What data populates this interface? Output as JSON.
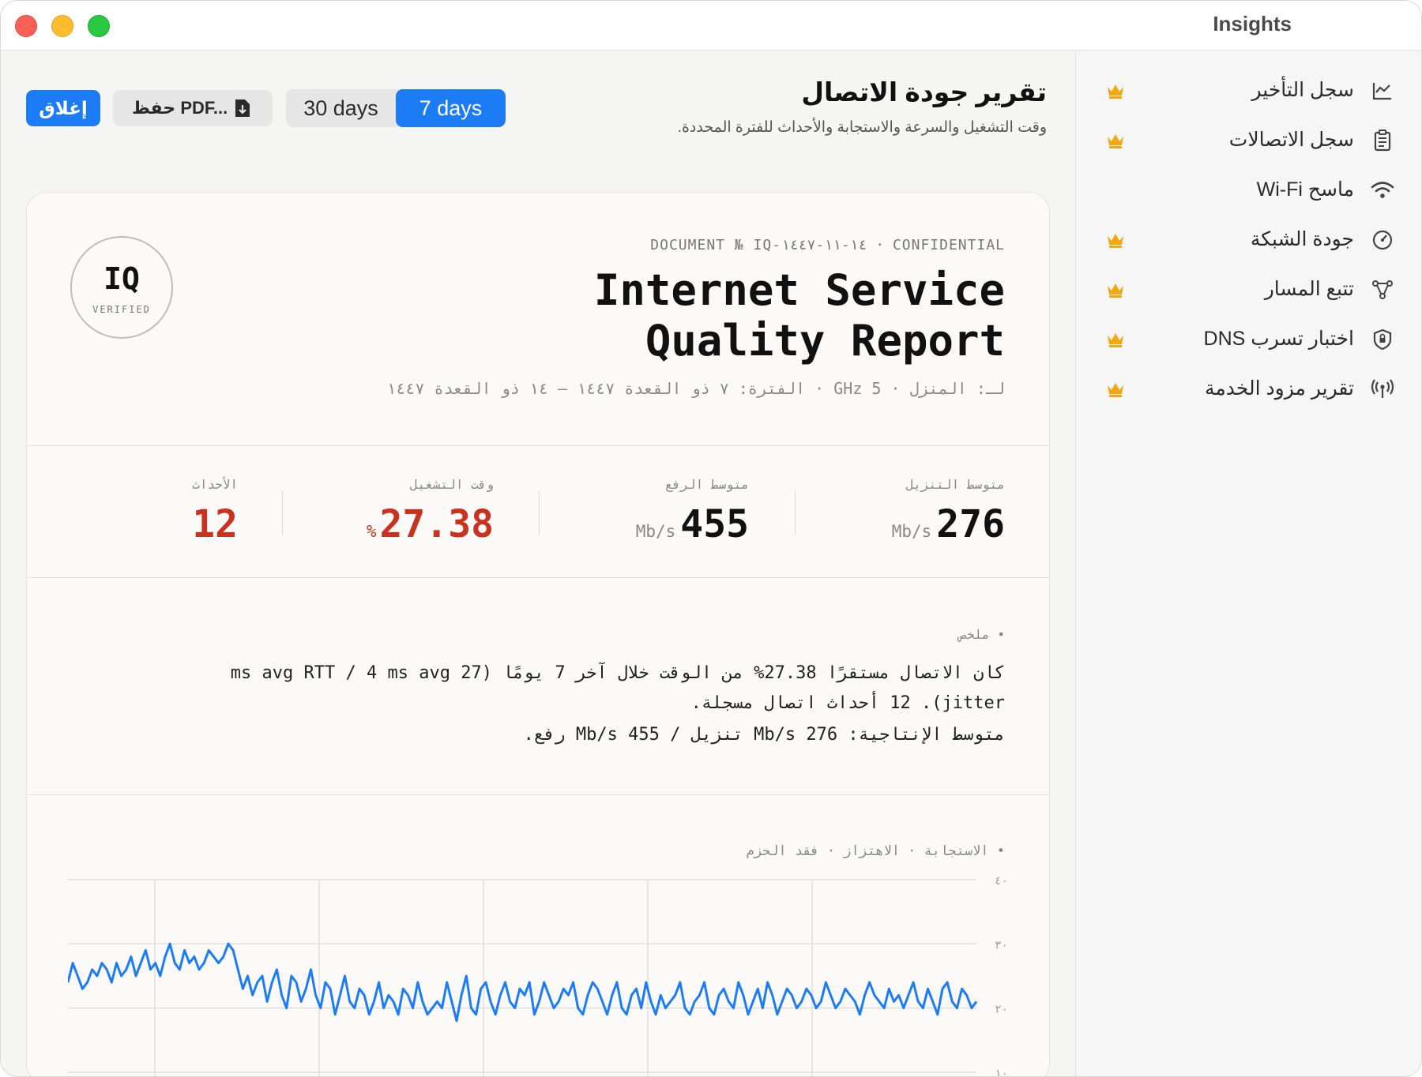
{
  "window": {
    "app_title": "Insights"
  },
  "toolbar": {
    "close_label": "إغلاق",
    "pdf_label": "حفظ PDF...",
    "range_30": "30 days",
    "range_7": "7 days",
    "selected_range": "7 days"
  },
  "header": {
    "title": "تقرير جودة الاتصال",
    "subtitle": "وقت التشغيل والسرعة والاستجابة والأحداث للفترة المحددة."
  },
  "sidebar": {
    "items": [
      {
        "label": "سجل التأخير",
        "icon": "chart-icon",
        "premium": true
      },
      {
        "label": "سجل الاتصالات",
        "icon": "clipboard-icon",
        "premium": true
      },
      {
        "label": "ماسح Wi-Fi",
        "icon": "wifi-icon",
        "premium": false
      },
      {
        "label": "جودة الشبكة",
        "icon": "gauge-icon",
        "premium": true
      },
      {
        "label": "تتبع المسار",
        "icon": "route-icon",
        "premium": true
      },
      {
        "label": "اختبار تسرب DNS",
        "icon": "shield-icon",
        "premium": true
      },
      {
        "label": "تقرير مزود الخدمة",
        "icon": "antenna-icon",
        "premium": true
      }
    ]
  },
  "report": {
    "seal_main": "IQ",
    "seal_sub": "VERIFIED",
    "document_line": "DOCUMENT № IQ-١٤-١١-١٤٤٧ · CONFIDENTIAL",
    "title_line1": "Internet Service",
    "title_line2": "Quality Report",
    "meta": "لـ: المنزل · 5 GHz · الفترة: ٧ ذو القعدة ١٤٤٧ — ١٤ ذو القعدة ١٤٤٧",
    "stats": {
      "download_label": "متوسط التنزيل",
      "download_value": "276",
      "download_unit": "Mb/s",
      "upload_label": "متوسط الرفع",
      "upload_value": "455",
      "upload_unit": "Mb/s",
      "uptime_label": "وقت التشغيل",
      "uptime_value": "27.38",
      "uptime_unit": "%",
      "events_label": "الأحداث",
      "events_value": "12"
    },
    "summary_label": "• ملخص",
    "summary_text": "كان الاتصال مستقرًا 27.38% من الوقت خلال آخر 7 يومًا (27 ms avg RTT / 4 ms avg jitter). 12 أحداث اتصال مسجلة.",
    "summary_text2": "متوسط الإنتاجية: 276 Mb/s تنزيل / 455 Mb/s رفع.",
    "legend": "• الاستجابة · الاهتزاز · فقد الحزم",
    "accent": "#1c7cf5",
    "alert_color": "#c8321f"
  },
  "chart_data": {
    "type": "line",
    "ylim": [
      10,
      40
    ],
    "yticks": [
      "٤٠",
      "٣٠",
      "٢٠",
      "١٠"
    ],
    "series": [
      {
        "values": [
          24,
          27,
          25,
          23,
          24,
          26,
          25,
          27,
          26,
          24,
          27,
          25,
          26,
          28,
          25,
          27,
          29,
          26,
          27,
          25,
          28,
          30,
          27,
          26,
          29,
          27,
          28,
          26,
          27,
          29,
          28,
          27,
          28,
          30,
          29,
          26,
          23,
          25,
          22,
          24,
          25,
          21,
          24,
          26,
          22,
          20,
          25,
          24,
          21,
          23,
          26,
          22,
          20,
          24,
          23,
          19,
          22,
          25,
          21,
          20,
          23,
          22,
          19,
          21,
          24,
          20,
          22,
          21,
          19,
          23,
          22,
          20,
          24,
          21,
          19,
          20,
          21,
          20,
          24,
          21,
          18,
          22,
          25,
          20,
          19,
          23,
          24,
          21,
          19,
          22,
          24,
          21,
          20,
          23,
          22,
          24,
          19,
          21,
          24,
          22,
          20,
          21,
          23,
          22,
          24,
          20,
          19,
          22,
          24,
          23,
          21,
          19,
          22,
          24,
          20,
          19,
          22,
          23,
          20,
          24,
          21,
          19,
          22,
          20,
          21,
          22,
          24,
          20,
          19,
          21,
          22,
          24,
          20,
          19,
          22,
          23,
          21,
          20,
          24,
          22,
          19,
          21,
          23,
          20,
          24,
          22,
          19,
          21,
          23,
          22,
          20,
          21,
          23,
          22,
          20,
          21,
          24,
          22,
          20,
          21,
          23,
          22,
          21,
          19,
          22,
          24,
          22,
          21,
          20,
          23,
          21,
          22,
          20,
          22,
          24,
          21,
          20,
          23,
          21,
          19,
          23,
          24,
          21,
          20,
          23,
          22,
          20,
          21
        ]
      }
    ]
  }
}
